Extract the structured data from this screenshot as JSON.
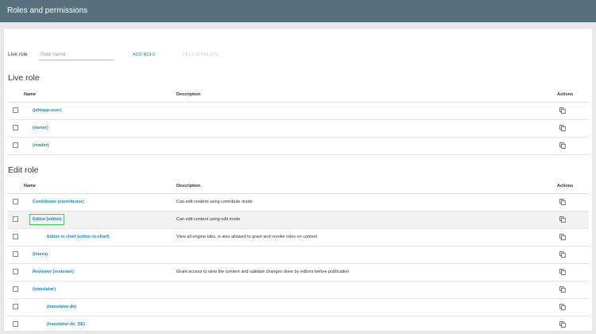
{
  "app": {
    "title": "Roles and permissions"
  },
  "toolbar": {
    "label": "Live role",
    "input_placeholder": "Role name",
    "add_label": "ADD ROLE",
    "delete_label": "DELETE ROLE(S)"
  },
  "live_section": {
    "title": "Live role",
    "columns": {
      "name": "Name",
      "description": "Description",
      "actions": "Actions"
    },
    "rows": [
      {
        "name": "(jahiapp-user)",
        "description": "",
        "indent": 0
      },
      {
        "name": "(owner)",
        "description": "",
        "indent": 0
      },
      {
        "name": "(reader)",
        "description": "",
        "indent": 0
      }
    ]
  },
  "edit_section": {
    "title": "Edit role",
    "columns": {
      "name": "Name",
      "description": "Description",
      "actions": "Actions"
    },
    "rows": [
      {
        "name": "Contributor (contributor)",
        "description": "Can edit content using contribute mode",
        "indent": 0
      },
      {
        "name": "Editor (editor)",
        "description": "Can edit content using edit mode",
        "indent": 0,
        "selected": true
      },
      {
        "name": "Editor in chief (editor-in-chief)",
        "description": "View all engine tabs, is also allowed to grant and revoke roles on content",
        "indent": 1
      },
      {
        "name": "(intern)",
        "description": "",
        "indent": 0
      },
      {
        "name": "Reviewer (reviewer)",
        "description": "Grant access to view the content and validate changes done by editors before publication",
        "indent": 0
      },
      {
        "name": "(translator)",
        "description": "",
        "indent": 0
      },
      {
        "name": "(translator-de)",
        "description": "",
        "indent": 1
      },
      {
        "name": "(translator-de_DE)",
        "description": "",
        "indent": 1
      }
    ]
  },
  "icons": {
    "row_action": "copy-icon"
  },
  "colors": {
    "topbar": "#56707d",
    "link": "#1a8bc0",
    "selection": "#3ad13a"
  }
}
